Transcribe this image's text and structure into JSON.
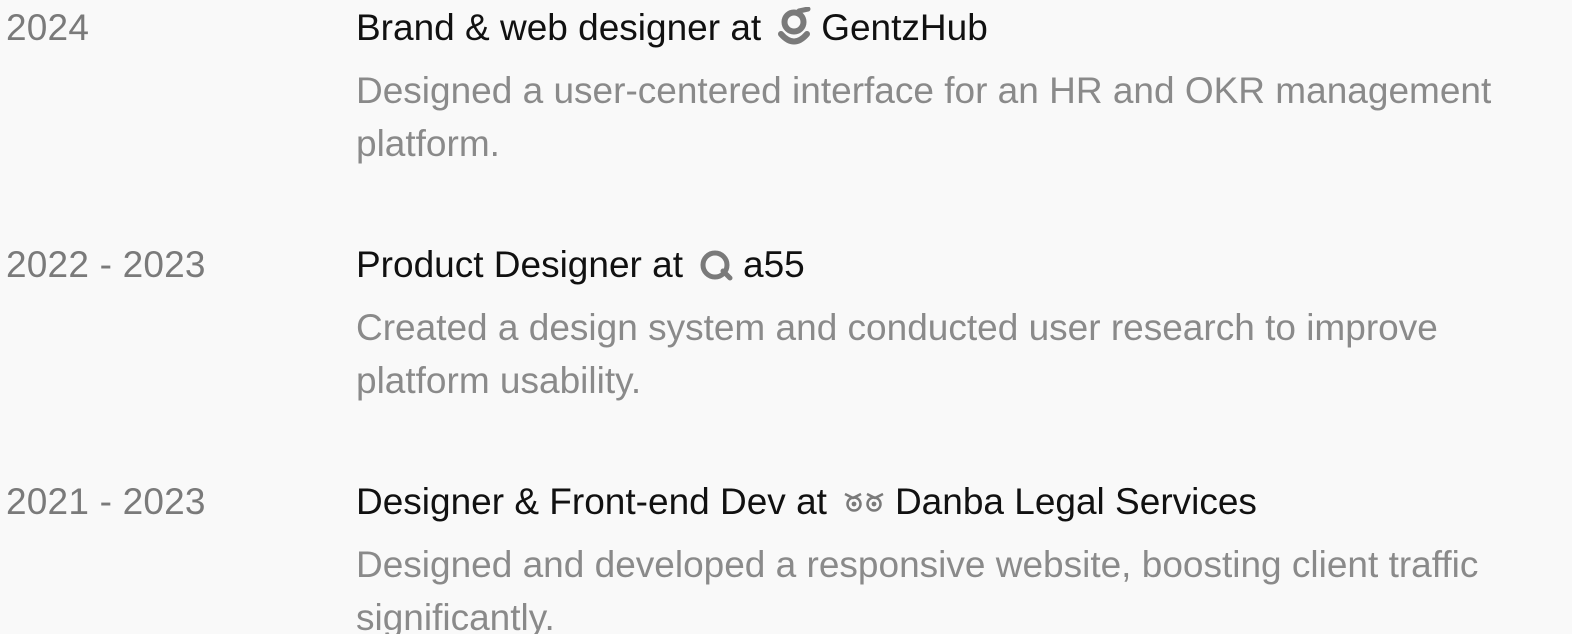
{
  "experience": [
    {
      "years": "2024",
      "role": "Brand & web designer at",
      "company": "GentzHub",
      "company_icon": "gentzhub-logo-icon",
      "description_lines": [
        "Designed a user-centered interface for an HR and OKR management",
        "platform."
      ]
    },
    {
      "years": "2022 - 2023",
      "role": "Product Designer at",
      "company": "a55",
      "company_icon": "a55-logo-icon",
      "description_lines": [
        "Created a design system and conducted user research to improve",
        "platform usability."
      ]
    },
    {
      "years": "2021 - 2023",
      "role": "Designer & Front-end Dev at",
      "company": "Danba Legal Services",
      "company_icon": "danba-owl-logo-icon",
      "description_lines": [
        "Designed and developed a responsive website, boosting client traffic",
        "significantly."
      ]
    }
  ],
  "colors": {
    "background": "#f9f9f9",
    "heading": "#111111",
    "year": "#7a7a7a",
    "description": "#8a8a8a",
    "logo": "#7a7a7a"
  }
}
